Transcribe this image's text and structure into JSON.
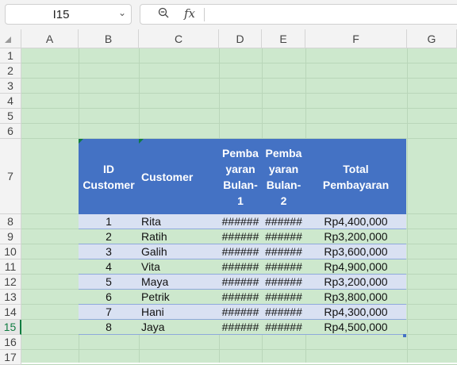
{
  "formula_bar": {
    "name_box": "I15",
    "formula": "",
    "zoom_icon": "zoom-out-icon",
    "fx_label": "fx"
  },
  "columns": [
    "A",
    "B",
    "C",
    "D",
    "E",
    "F",
    "G"
  ],
  "rows": [
    "1",
    "2",
    "3",
    "4",
    "5",
    "6",
    "7",
    "8",
    "9",
    "10",
    "11",
    "12",
    "13",
    "14",
    "15",
    "16",
    "17"
  ],
  "active_row": "15",
  "colors": {
    "sheet_fill": "#cde8cd",
    "header_fill": "#4472c4",
    "band_fill": "#d9e1f2",
    "accent": "#107c41"
  },
  "table": {
    "headers": {
      "id": [
        "ID",
        "Customer"
      ],
      "customer": [
        "Customer"
      ],
      "d": [
        "Pemba",
        "yaran",
        "Bulan-",
        "1"
      ],
      "e": [
        "Pemba",
        "yaran",
        "Bulan-",
        "2"
      ],
      "total": [
        "Total",
        "Pembayaran"
      ]
    },
    "rows": [
      {
        "id": "1",
        "name": "Rita",
        "d": "######",
        "e": "######",
        "total": "Rp4,400,000"
      },
      {
        "id": "2",
        "name": "Ratih",
        "d": "######",
        "e": "######",
        "total": "Rp3,200,000"
      },
      {
        "id": "3",
        "name": "Galih",
        "d": "######",
        "e": "######",
        "total": "Rp3,600,000"
      },
      {
        "id": "4",
        "name": "Vita",
        "d": "######",
        "e": "######",
        "total": "Rp4,900,000"
      },
      {
        "id": "5",
        "name": "Maya",
        "d": "######",
        "e": "######",
        "total": "Rp3,200,000"
      },
      {
        "id": "6",
        "name": "Petrik",
        "d": "######",
        "e": "######",
        "total": "Rp3,800,000"
      },
      {
        "id": "7",
        "name": "Hani",
        "d": "######",
        "e": "######",
        "total": "Rp4,300,000"
      },
      {
        "id": "8",
        "name": "Jaya",
        "d": "######",
        "e": "######",
        "total": "Rp4,500,000"
      }
    ]
  }
}
